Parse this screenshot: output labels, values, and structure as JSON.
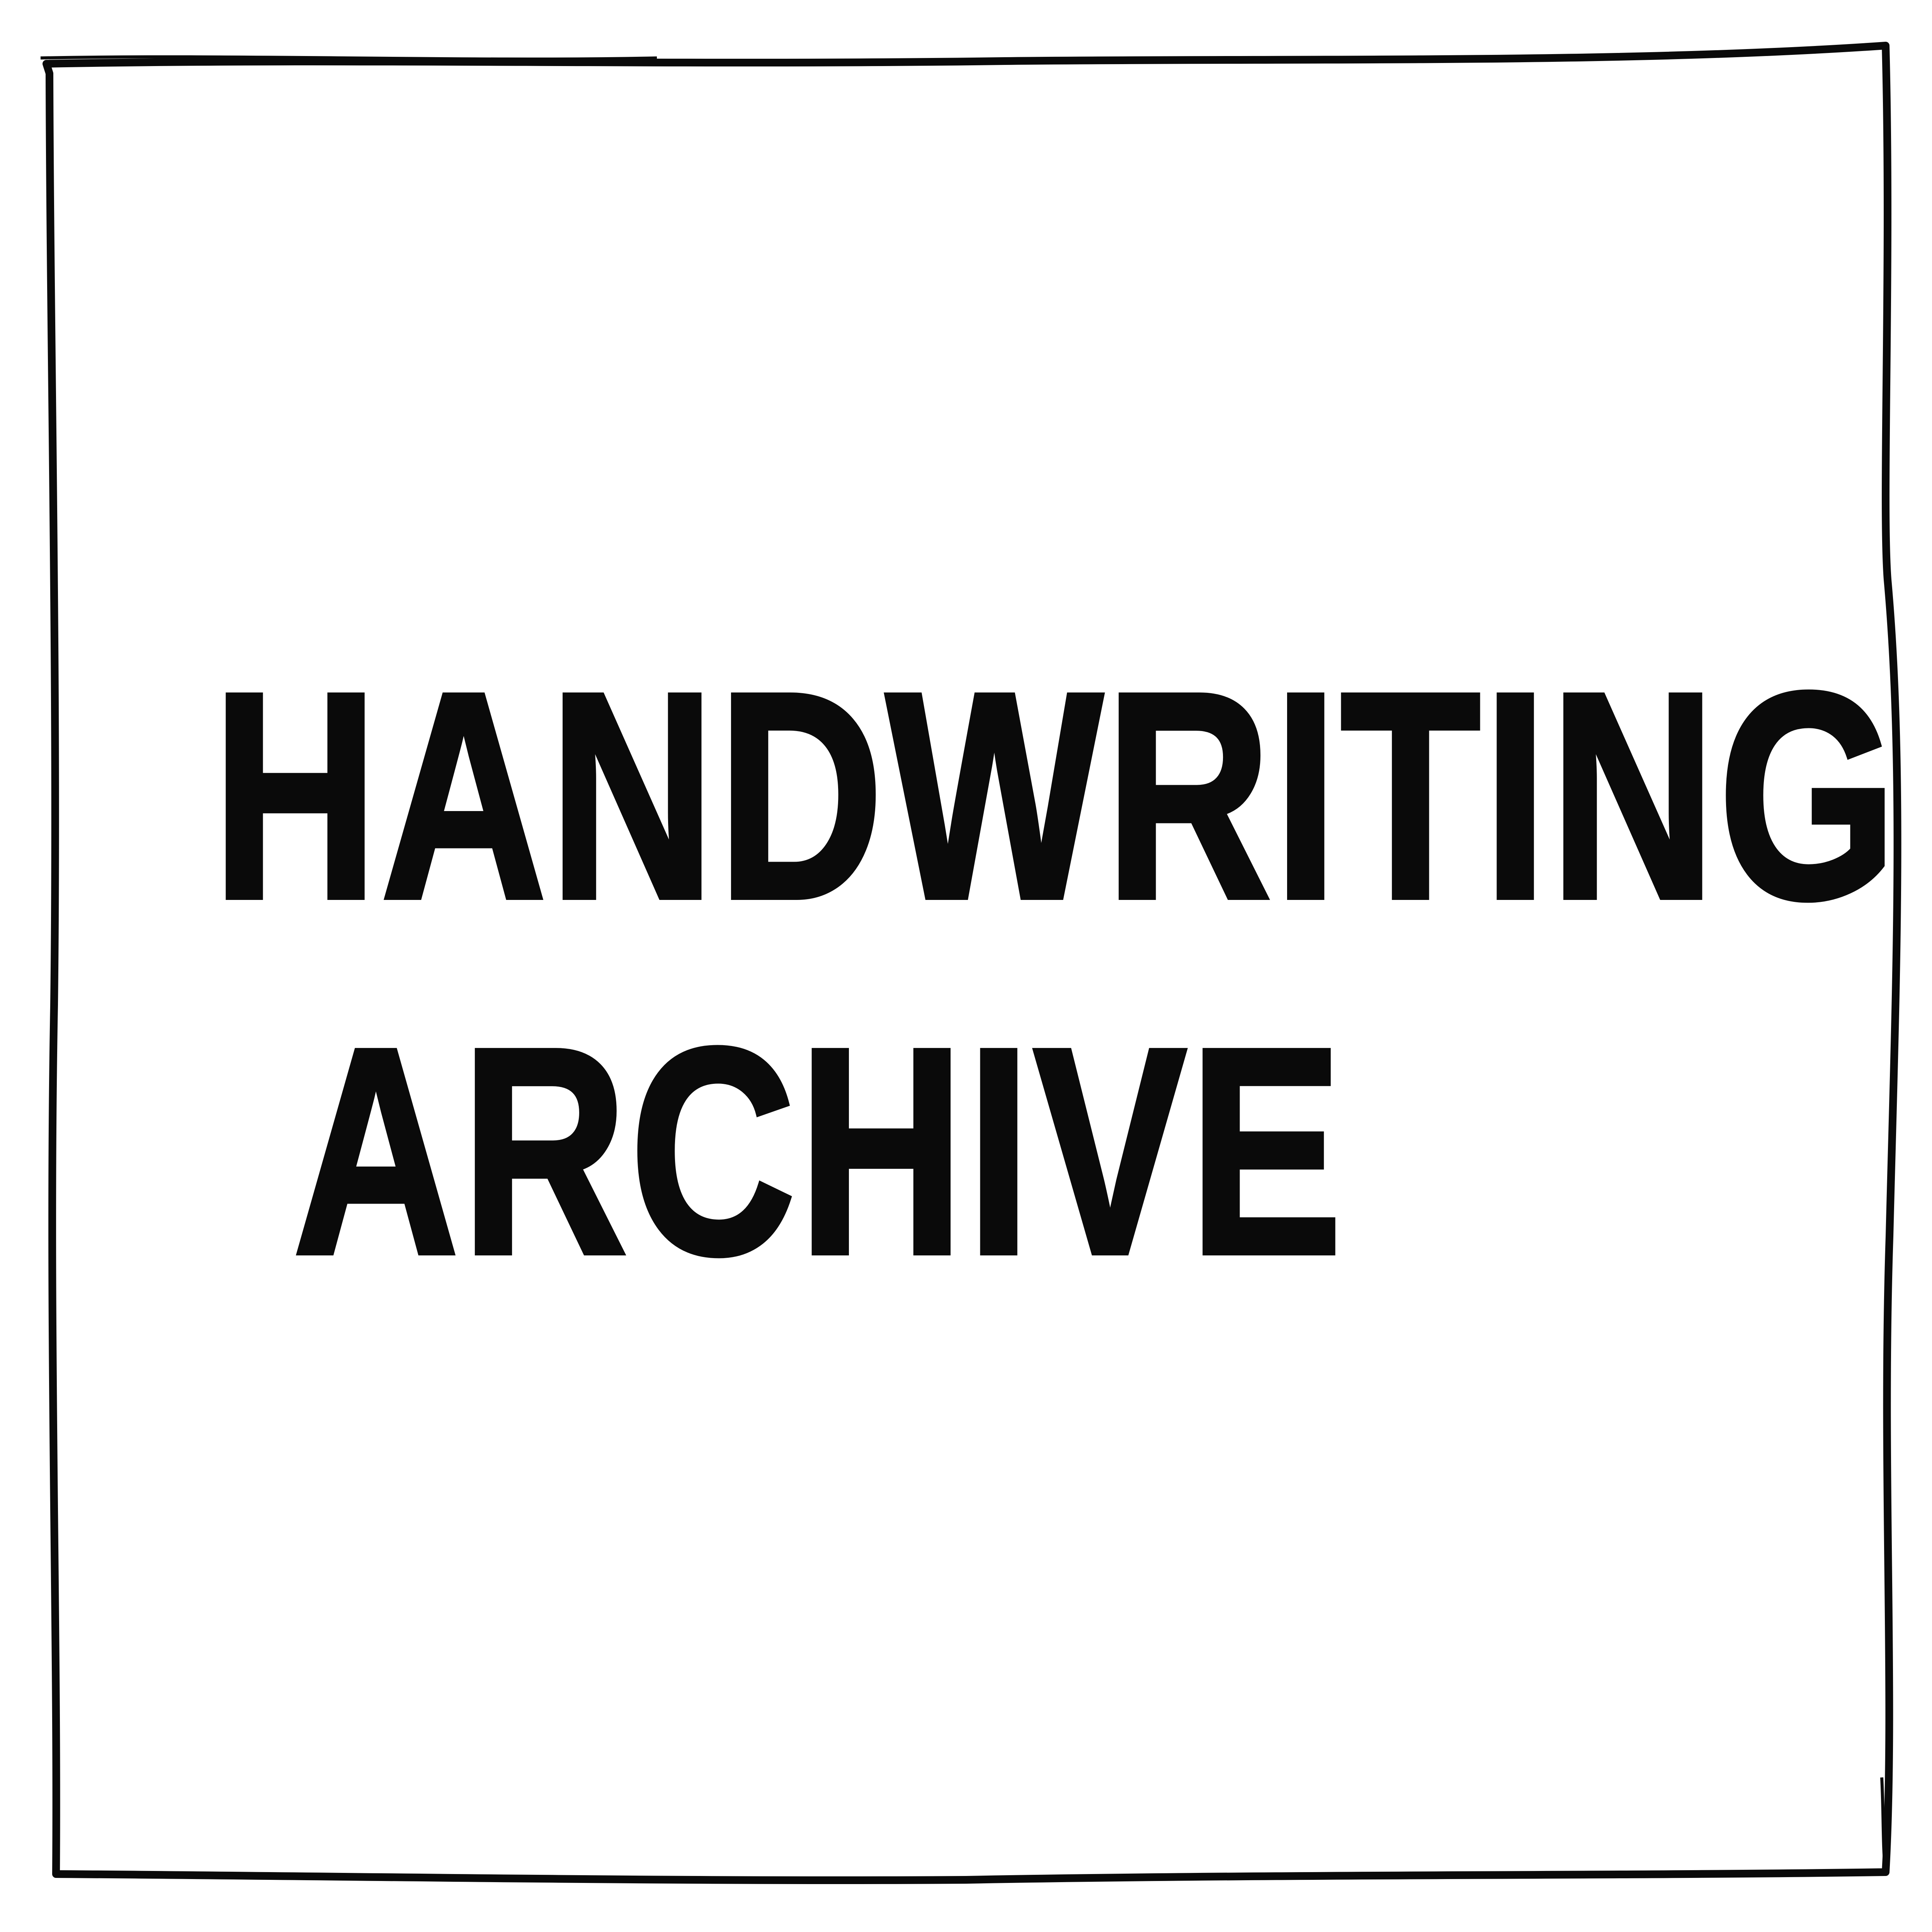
{
  "title": {
    "line1": "HANDWRITING",
    "line2": "ARCHIVE"
  },
  "colors": {
    "ink": "#0a0a0a",
    "paper": "#ffffff"
  }
}
